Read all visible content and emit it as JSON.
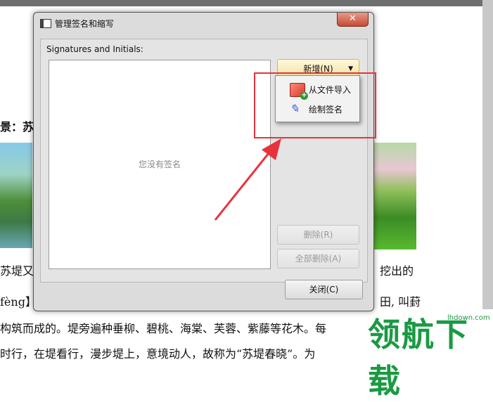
{
  "document": {
    "line_heading": "景：苏",
    "line1_left": "苏堤又",
    "line1_right": "挖出的",
    "line2_left": "fèng】",
    "line2_right": "田, 叫葑",
    "line3": "构筑而成的。堤旁遍种垂柳、碧桃、海棠、芙蓉、紫藤等花木。每",
    "line4": "时行，在堤看行，漫步堤上，意境动人，故称为“苏堤春晓”。为"
  },
  "dialog": {
    "title": "管理签名和缩写",
    "close_glyph": "✕",
    "section_label": "Signatures and Initials:",
    "empty_text": "您没有签名",
    "new_button": "新增(N)",
    "delete_button": "删除(R)",
    "delete_all_button": "全部删除(A)",
    "close_button": "关闭(C)"
  },
  "menu": {
    "items": [
      {
        "label": "从文件导入",
        "icon": "image-import-icon"
      },
      {
        "label": "绘制签名",
        "icon": "pen-signature-icon"
      }
    ]
  },
  "watermark": {
    "text": "领航下载",
    "url": "lhdown.com"
  },
  "colors": {
    "highlight": "#e8323c",
    "watermark": "#1a9a43"
  }
}
